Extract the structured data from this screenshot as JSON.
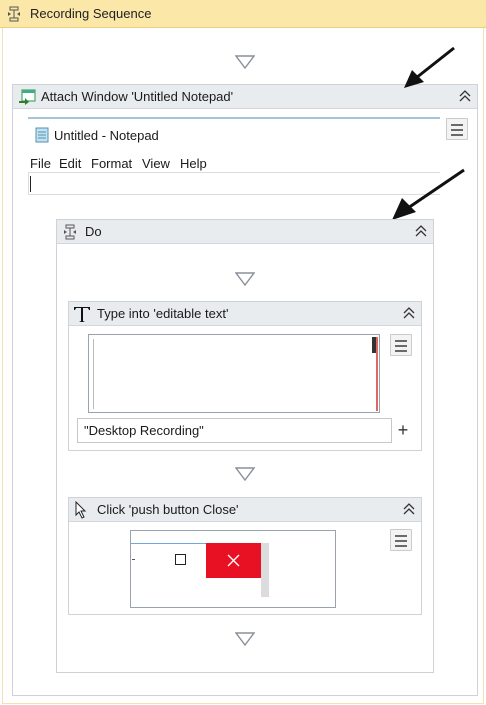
{
  "sequence": {
    "title": "Recording Sequence"
  },
  "attach": {
    "title": "Attach Window 'Untitled  Notepad'",
    "window_title": "Untitled - Notepad",
    "menu": [
      "File",
      "Edit",
      "Format",
      "View",
      "Help"
    ]
  },
  "do_block": {
    "title": "Do"
  },
  "type_into": {
    "title": "Type into 'editable text'",
    "text_value": "\"Desktop Recording\"",
    "plus_label": "+"
  },
  "click": {
    "title": "Click 'push button  Close'"
  },
  "icons": {
    "sequence": "sequence-icon",
    "attach": "attach-window-icon",
    "type": "type-into-icon",
    "click": "cursor-icon",
    "collapse": "chevron-double-up-icon",
    "menu": "hamburger-icon",
    "drop": "drop-target-triangle-icon"
  },
  "colors": {
    "header_bg": "#fbe7a8",
    "close_button": "#e81123",
    "activity_head": "#e9ecef"
  }
}
